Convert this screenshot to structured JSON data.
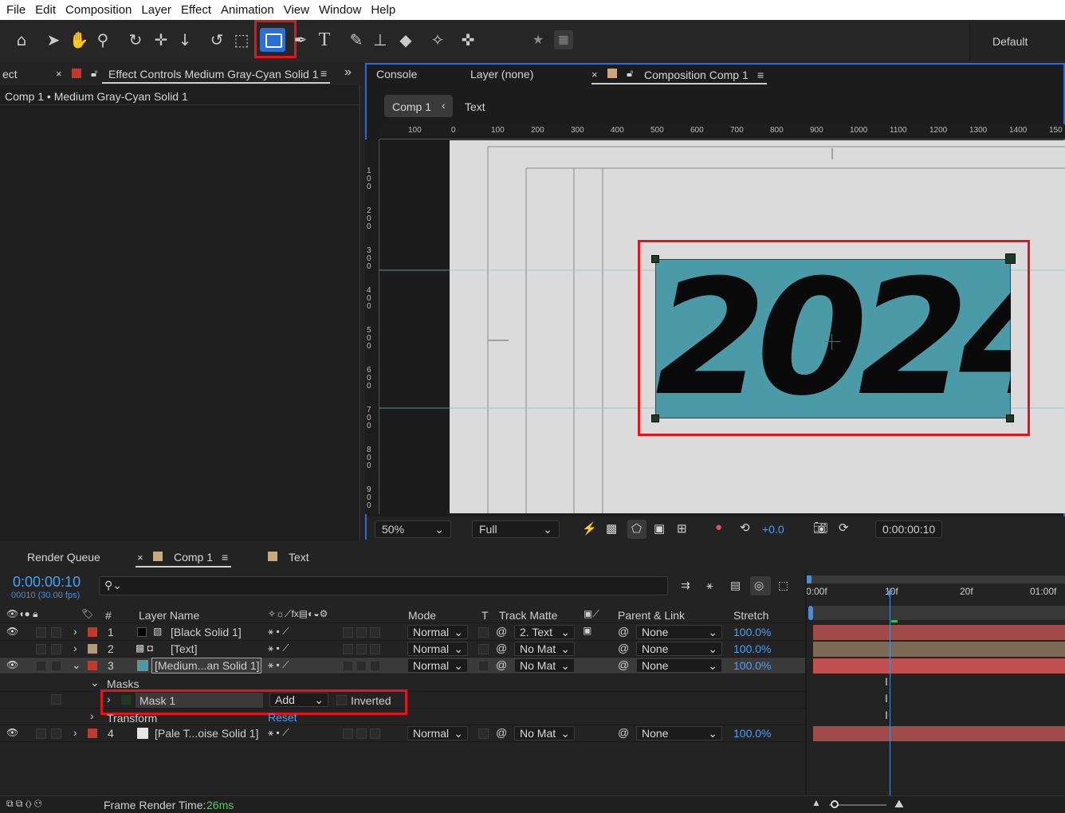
{
  "menu": [
    "File",
    "Edit",
    "Composition",
    "Layer",
    "Effect",
    "Animation",
    "View",
    "Window",
    "Help"
  ],
  "toolbar": {
    "icons": [
      "home-icon",
      "selection-arrow-icon",
      "hand-icon",
      "zoom-icon",
      "orbit-camera-icon",
      "pan-camera-icon",
      "dolly-camera-icon",
      "rotate-icon",
      "pan-behind-icon",
      "rectangle-tool-icon",
      "pen-icon",
      "type-icon",
      "brush-icon",
      "clone-stamp-icon",
      "eraser-icon",
      "roto-brush-icon",
      "puppet-pin-icon",
      "star-icon",
      "snapping-icon"
    ],
    "workspace": "Default"
  },
  "left_panel": {
    "tab_prefix": "ect",
    "tab_title": "Effect Controls Medium Gray-Cyan Solid 1",
    "subtitle": "Comp 1 • Medium Gray-Cyan Solid 1"
  },
  "viewer": {
    "tabs": [
      "Console",
      "Layer (none)",
      "Composition Comp 1"
    ],
    "breadcrumb": [
      "Comp 1",
      "Text"
    ],
    "ruler_top": [
      "100",
      "0",
      "100",
      "200",
      "300",
      "400",
      "500",
      "600",
      "700",
      "800",
      "900",
      "1000",
      "1100",
      "1200",
      "1300",
      "1400",
      "150"
    ],
    "ruler_left": [
      "1\n0\n0",
      "2\n0\n0",
      "3\n0\n0",
      "4\n0\n0",
      "5\n0\n0",
      "6\n0\n0",
      "7\n0\n0",
      "8\n0\n0",
      "9\n0\n0"
    ],
    "canvas_text": "2024",
    "layer_color": "#4b9aa8",
    "zoom": "50%",
    "resolution": "Full",
    "exposure": "+0.0",
    "timecode": "0:00:00:10"
  },
  "timeline": {
    "tabs": [
      "Render Queue",
      "Comp 1",
      "Text"
    ],
    "timecode": "0:00:00:10",
    "frame_info": "00010 (30.00 fps)",
    "search_placeholder": "",
    "columns": [
      "#",
      "Layer Name",
      "Mode",
      "T",
      "Track Matte",
      "Parent & Link",
      "Stretch"
    ],
    "ruler": [
      "0:00f",
      "10f",
      "20f",
      "01:00f"
    ],
    "layers": [
      {
        "num": "1",
        "name": "[Black Solid 1]",
        "mode": "Normal",
        "matte": "2. Text",
        "parent": "None",
        "stretch": "100.0%",
        "label": "#c0392b",
        "swatch": "#000000"
      },
      {
        "num": "2",
        "name": "[Text]",
        "mode": "Normal",
        "matte": "No Mat",
        "parent": "None",
        "stretch": "100.0%",
        "label": "#b49a7a",
        "swatch": ""
      },
      {
        "num": "3",
        "name": "[Medium...an Solid 1]",
        "mode": "Normal",
        "matte": "No Mat",
        "parent": "None",
        "stretch": "100.0%",
        "label": "#c0392b",
        "swatch": "#4b9aa8"
      },
      {
        "num": "4",
        "name": "[Pale T...oise Solid 1]",
        "mode": "Normal",
        "matte": "No Mat",
        "parent": "None",
        "stretch": "100.0%",
        "label": "#c0392b",
        "swatch": "#e6e6e6"
      }
    ],
    "masks_label": "Masks",
    "mask": {
      "name": "Mask 1",
      "mode": "Add",
      "inverted_label": "Inverted"
    },
    "transform_label": "Transform",
    "reset_label": "Reset",
    "render_time_label": "Frame Render Time:",
    "render_time_value": "26ms"
  }
}
